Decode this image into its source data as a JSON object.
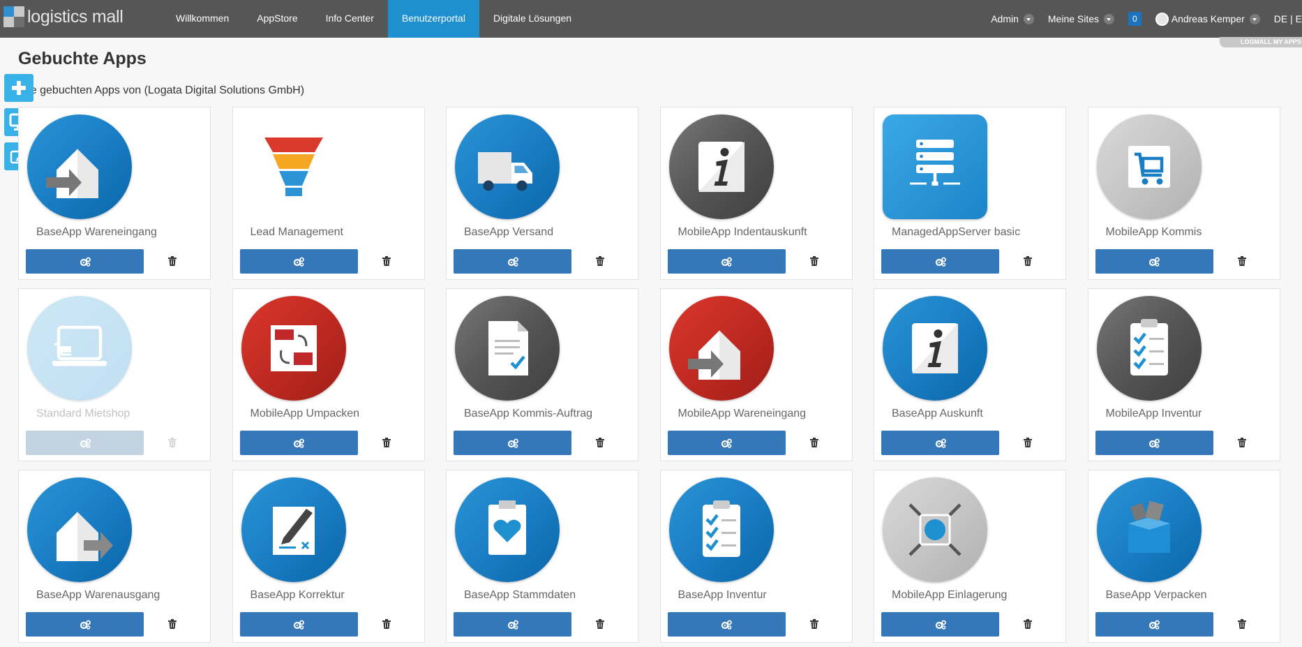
{
  "logo": {
    "text": "logistics mall"
  },
  "nav": {
    "items": [
      {
        "label": "Willkommen",
        "active": false
      },
      {
        "label": "AppStore",
        "active": false
      },
      {
        "label": "Info Center",
        "active": false
      },
      {
        "label": "Benutzerportal",
        "active": true
      },
      {
        "label": "Digitale Lösungen",
        "active": false
      }
    ]
  },
  "topright": {
    "admin": "Admin",
    "sites": "Meine Sites",
    "notifications": "0",
    "user": "Andreas Kemper",
    "lang": "DE | E"
  },
  "myapps_tab": "LOGMALL MY APPS",
  "page": {
    "title": "Gebuchte Apps",
    "subtitle": "Alle gebuchten Apps von (Logata Digital Solutions GmbH)"
  },
  "apps": [
    {
      "name": "BaseApp Wareneingang",
      "icon": "house-arrow-in-icon",
      "color": "blue",
      "enabled": true
    },
    {
      "name": "Lead Management",
      "icon": "leads-funnel-icon",
      "color": "funnel",
      "enabled": true
    },
    {
      "name": "BaseApp Versand",
      "icon": "truck-icon",
      "color": "blue",
      "enabled": true
    },
    {
      "name": "MobileApp Indentauskunft",
      "icon": "info-icon",
      "color": "gray",
      "enabled": true
    },
    {
      "name": "ManagedAppServer basic",
      "icon": "server-icon",
      "color": "blue-square",
      "enabled": true
    },
    {
      "name": "MobileApp Kommis",
      "icon": "cart-icon",
      "color": "lightgray",
      "enabled": true
    },
    {
      "name": "Standard Mietshop",
      "icon": "laptop-cart-icon",
      "color": "lightblue",
      "enabled": false
    },
    {
      "name": "MobileApp Umpacken",
      "icon": "repack-icon",
      "color": "red",
      "enabled": true
    },
    {
      "name": "BaseApp Kommis-Auftrag",
      "icon": "document-check-icon",
      "color": "gray",
      "enabled": true
    },
    {
      "name": "MobileApp Wareneingang",
      "icon": "house-arrow-in-icon",
      "color": "red",
      "enabled": true
    },
    {
      "name": "BaseApp Auskunft",
      "icon": "info-icon",
      "color": "blue",
      "enabled": true
    },
    {
      "name": "MobileApp Inventur",
      "icon": "checklist-icon",
      "color": "gray",
      "enabled": true
    },
    {
      "name": "BaseApp Warenausgang",
      "icon": "house-arrow-out-icon",
      "color": "blue",
      "enabled": true
    },
    {
      "name": "BaseApp Korrektur",
      "icon": "pen-edit-icon",
      "color": "blue",
      "enabled": true
    },
    {
      "name": "BaseApp Stammdaten",
      "icon": "clipboard-heart-icon",
      "color": "blue",
      "enabled": true
    },
    {
      "name": "BaseApp Inventur",
      "icon": "checklist-icon",
      "color": "blue",
      "enabled": true
    },
    {
      "name": "MobileApp Einlagerung",
      "icon": "store-in-icon",
      "color": "lightgray",
      "enabled": true
    },
    {
      "name": "BaseApp Verpacken",
      "icon": "box-icon",
      "color": "blue",
      "enabled": true
    }
  ],
  "colors": {
    "topbar": "#565656",
    "active_nav": "#1e90cf",
    "button": "#3578b9",
    "side_button": "#38b1e6"
  }
}
